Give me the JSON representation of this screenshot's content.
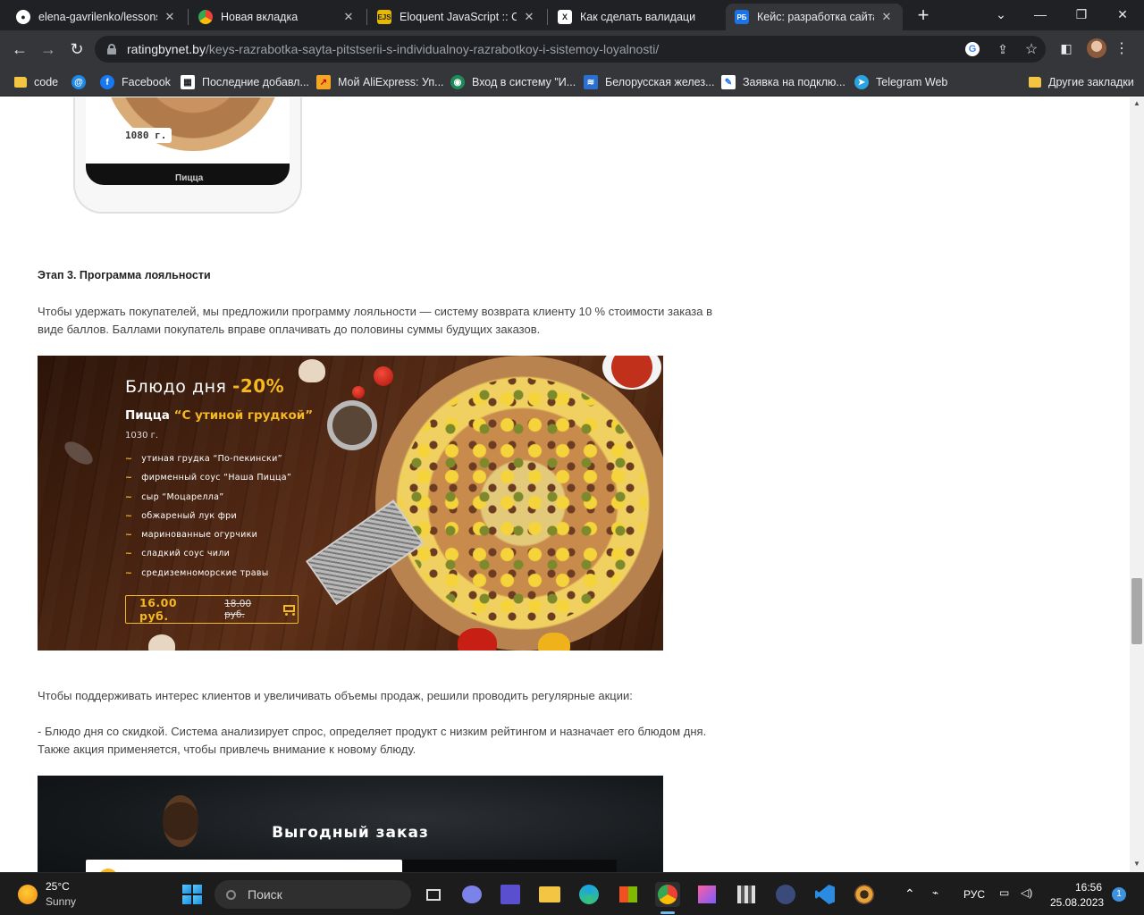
{
  "tabs": [
    {
      "title": "elena-gavrilenko/lessons",
      "icon": "github-icon",
      "close": "✕"
    },
    {
      "title": "Новая вкладка",
      "icon": "chrome-icon",
      "close": "✕"
    },
    {
      "title": "Eloquent JavaScript :: Coc",
      "icon": "ejs-icon",
      "favtext": "EJS",
      "close": "✕"
    },
    {
      "title": "Как сделать валидацию",
      "icon": "x-icon",
      "favtext": "X",
      "close": "✕"
    },
    {
      "title": "Кейс: разработка сайта п",
      "icon": "rb-icon",
      "favtext": "РБ",
      "close": "✕",
      "active": true
    }
  ],
  "window": {
    "new_tab": "+",
    "chevron": "⌄",
    "minimize": "—",
    "restore": "❐",
    "close": "✕"
  },
  "nav": {
    "back": "←",
    "forward": "→",
    "reload": "↻"
  },
  "address": {
    "domain": "ratingbynet.by",
    "path": "/keys-razrabotka-sayta-pitstserii-s-individualnoy-razrabotkoy-i-sistemoy-loyalnosti/"
  },
  "omnibox_icons": {
    "google": "G",
    "share": "⇪",
    "star": "☆",
    "sidepanel": "◧",
    "menu": "⋮"
  },
  "bookmarks": [
    {
      "label": "code",
      "icon": "folder-icon"
    },
    {
      "label": "",
      "icon": "at-icon"
    },
    {
      "label": "Facebook",
      "icon": "facebook-icon"
    },
    {
      "label": "Последние добавл...",
      "icon": "film-icon"
    },
    {
      "label": "Мой AliExpress: Уп...",
      "icon": "aliexpress-icon"
    },
    {
      "label": "Вход в систему \"И...",
      "icon": "globe-icon"
    },
    {
      "label": "Белорусская желез...",
      "icon": "rail-icon"
    },
    {
      "label": "Заявка на подклю...",
      "icon": "page-icon"
    },
    {
      "label": "Telegram Web",
      "icon": "telegram-icon"
    },
    {
      "label": "Другие закладки",
      "icon": "folder-icon"
    }
  ],
  "article": {
    "phone_weight": "1080 г.",
    "phone_caption": "Пицца",
    "stage_heading": "Этап 3. Программа лояльности",
    "para1": "Чтобы удержать покупателей, мы предложили программу лояльности — систему возврата клиенту 10 % стоимости заказа в виде баллов. Баллами покупатель вправе оплачивать до половины суммы будущих заказов.",
    "para2": "Чтобы поддерживать интерес клиентов и увеличивать объемы продаж, решили проводить регулярные акции:",
    "para3": "- Блюдо дня со скидкой. Система анализирует спрос, определяет продукт с низким рейтингом и назначает его блюдом дня. Также акция применяется, чтобы привлечь внимание к новому блюду."
  },
  "banner1": {
    "title": "Блюдо дня ",
    "discount": "-20%",
    "pizza_prefix": "Пицца ",
    "pizza_name": "“С утиной грудкой”",
    "weight": "1030 г.",
    "bullet": "~",
    "ingredients": [
      "утиная грудка “По-пекински”",
      "фирменный соус “Наша Пицца”",
      "сыр “Моцарелла”",
      "обжареный лук фри",
      "маринованные огурчики",
      "сладкий соус чили",
      "средиземноморские травы"
    ],
    "new_price": "16.00 руб.",
    "old_price": "18.00 руб."
  },
  "banner2": {
    "title": "Выгодный заказ"
  },
  "taskbar": {
    "temp": "25°C",
    "condition": "Sunny",
    "search": "Поиск",
    "lang": "РУС",
    "time": "16:56",
    "date": "25.08.2023",
    "notifications": "1",
    "tray_chevron": "⌃"
  },
  "colors": {
    "accent": "#f5b821",
    "chrome_dark": "#202124",
    "chrome_mid": "#35363a",
    "text": "#444444"
  }
}
